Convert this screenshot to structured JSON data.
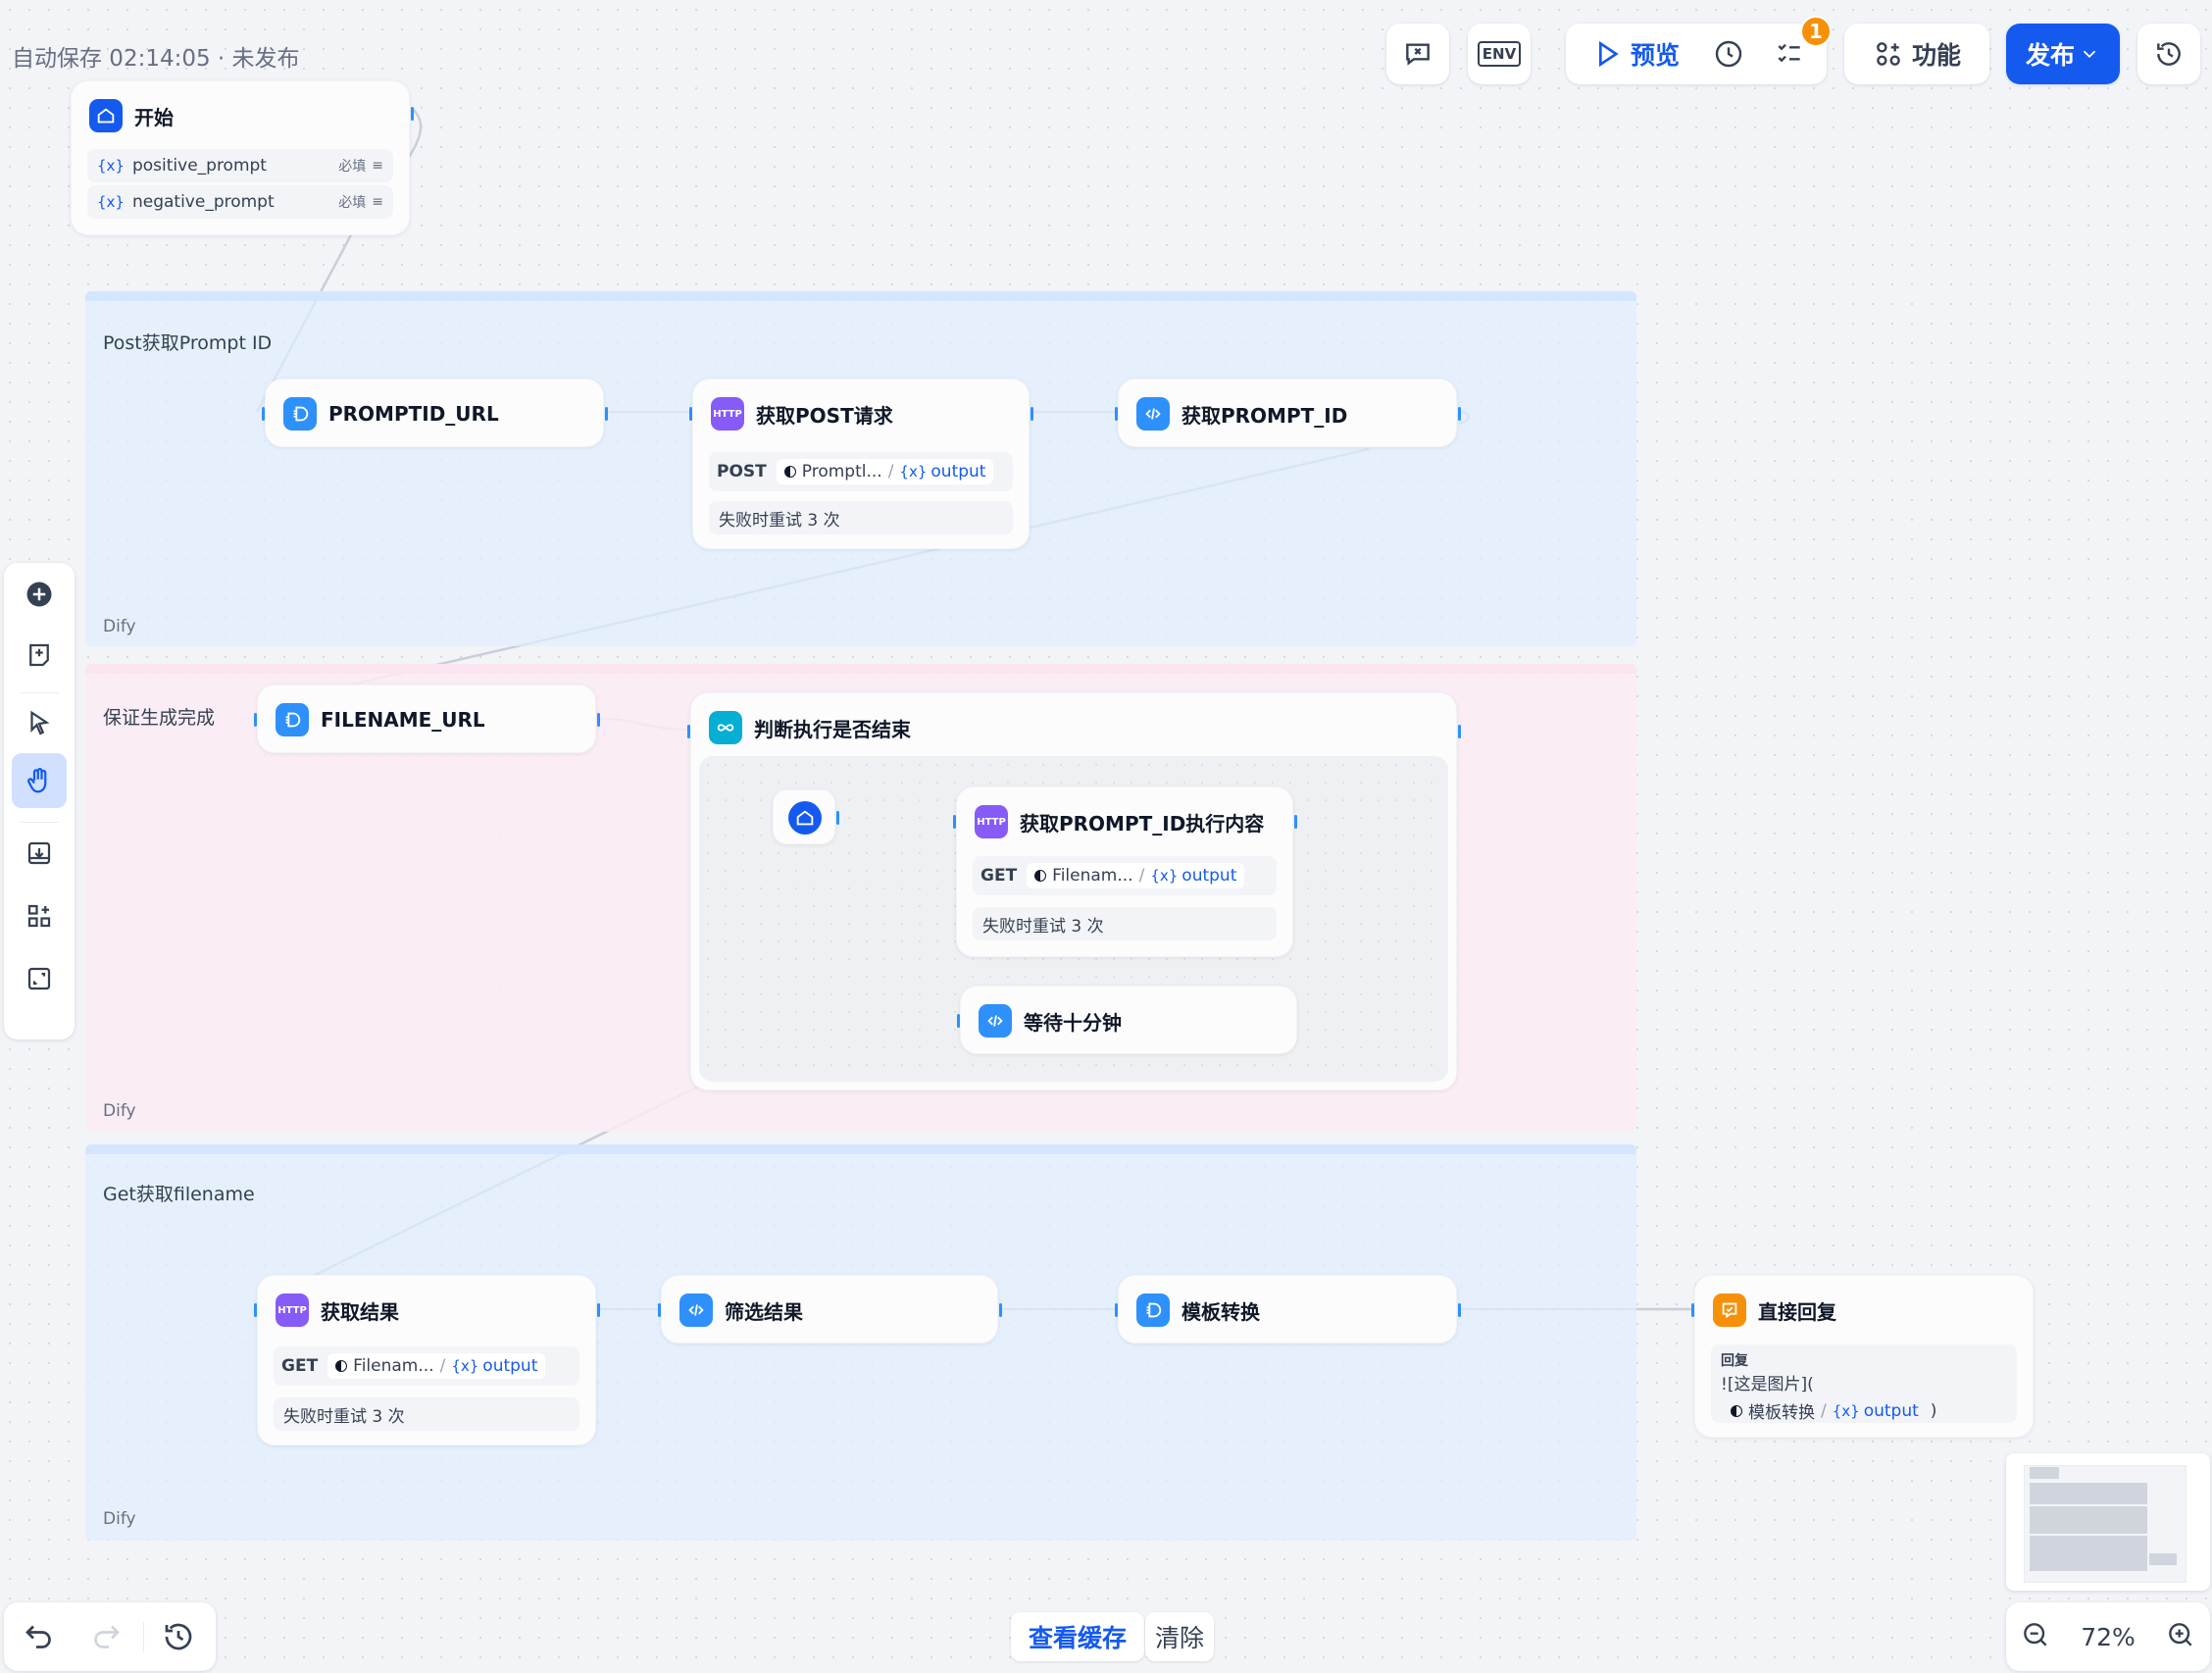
{
  "header": {
    "autosave": "自动保存 02:14:05 · 未发布",
    "toolbar": {
      "preview": "预览",
      "features": "功能",
      "publish": "发布",
      "badge_count": "1",
      "env_label": "ENV"
    }
  },
  "groups": [
    {
      "title": "Post获取Prompt ID",
      "footer": "Dify"
    },
    {
      "title": "保证生成完成",
      "footer": "Dify"
    },
    {
      "title": "Get获取filename",
      "footer": "Dify"
    }
  ],
  "nodes": {
    "start": {
      "title": "开始",
      "vars": [
        {
          "name": "positive_prompt",
          "required": "必填"
        },
        {
          "name": "negative_prompt",
          "required": "必填"
        }
      ]
    },
    "promptid_url": {
      "title": "PROMPTID_URL"
    },
    "post_request": {
      "title": "获取POST请求",
      "method": "POST",
      "source": "Promptl...",
      "output": "output",
      "retry": "失败时重试 3 次"
    },
    "get_prompt_id": {
      "title": "获取PROMPT_ID"
    },
    "filename_url": {
      "title": "FILENAME_URL"
    },
    "loop": {
      "title": "判断执行是否结束"
    },
    "get_content": {
      "title": "获取PROMPT_ID执行内容",
      "method": "GET",
      "source": "Filenam...",
      "output": "output",
      "retry": "失败时重试 3 次"
    },
    "wait": {
      "title": "等待十分钟"
    },
    "get_result": {
      "title": "获取结果",
      "method": "GET",
      "source": "Filenam...",
      "output": "output",
      "retry": "失败时重试 3 次"
    },
    "filter": {
      "title": "筛选结果"
    },
    "template": {
      "title": "模板转换"
    },
    "answer": {
      "title": "直接回复",
      "label": "回复",
      "text": "![这是图片](",
      "ref_node": "模板转换",
      "ref_var": "output",
      "close": ")"
    }
  },
  "bottom": {
    "view_cache": "查看缓存",
    "clear": "清除",
    "zoom": "72%"
  },
  "colors": {
    "accent": "#155aef",
    "http": "#875bf7",
    "code": "#2e90fa",
    "loop": "#06aed4",
    "answer": "#f79009"
  },
  "icons": [
    "home-icon",
    "variable-icon",
    "http-icon",
    "code-icon",
    "loop-icon",
    "answer-icon",
    "template-icon",
    "add-icon",
    "note-icon",
    "pointer-icon",
    "hand-icon",
    "export-icon",
    "layout-icon",
    "fit-icon",
    "undo-icon",
    "redo-icon",
    "history-icon",
    "zoom-out-icon",
    "zoom-in-icon"
  ]
}
